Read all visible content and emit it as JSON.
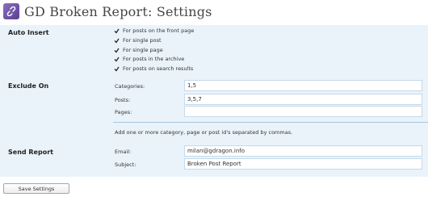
{
  "header": {
    "title": "GD Broken Report: Settings",
    "logo_icon": "broken-link-icon",
    "logo_color": "#6b4fa3"
  },
  "auto_insert": {
    "label": "Auto Insert",
    "options": [
      {
        "label": "For posts on the front page",
        "checked": true
      },
      {
        "label": "For single post",
        "checked": true
      },
      {
        "label": "For single page",
        "checked": true
      },
      {
        "label": "For posts in the archive",
        "checked": true
      },
      {
        "label": "For posts on search results",
        "checked": true
      }
    ]
  },
  "exclude_on": {
    "label": "Exclude On",
    "categories_label": "Categories:",
    "categories_value": "1,5",
    "posts_label": "Posts:",
    "posts_value": "3,5,7",
    "pages_label": "Pages:",
    "pages_value": "",
    "hint": "Add one or more category, page or post id's separated by commas."
  },
  "send_report": {
    "label": "Send Report",
    "email_label": "Email:",
    "email_value": "milan@gdragon.info",
    "subject_label": "Subject:",
    "subject_value": "Broken Post Report"
  },
  "actions": {
    "save_label": "Save Settings"
  },
  "colors": {
    "form_background": "#eaf3fa",
    "input_border": "#c6d9e9"
  }
}
